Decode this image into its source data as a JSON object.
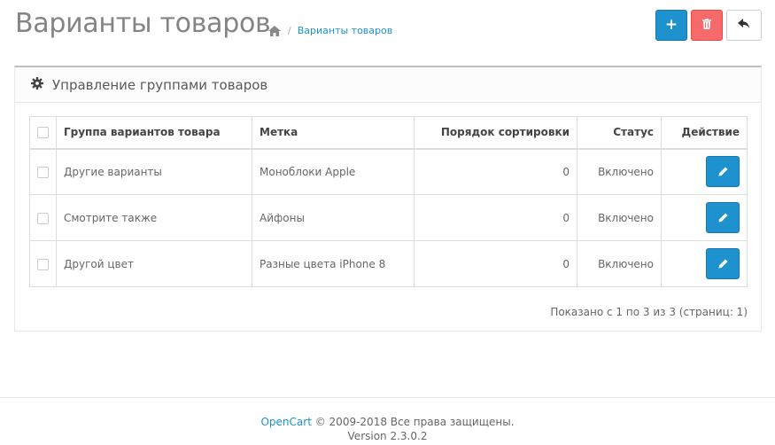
{
  "header": {
    "title": "Варианты товаров",
    "breadcrumb": {
      "current": "Варианты товаров"
    },
    "buttons": {
      "add": "+",
      "delete": "trash-icon",
      "back": "reply-icon"
    }
  },
  "panel": {
    "title": "Управление группами товаров",
    "table": {
      "headers": {
        "group": "Группа вариантов товара",
        "label": "Метка",
        "sort": "Порядок сортировки",
        "status": "Статус",
        "action": "Действие"
      },
      "rows": [
        {
          "group": "Другие варианты",
          "label": "Моноблоки Apple",
          "sort": "0",
          "status": "Включено"
        },
        {
          "group": "Смотрите также",
          "label": "Айфоны",
          "sort": "0",
          "status": "Включено"
        },
        {
          "group": "Другой цвет",
          "label": "Разные цвета iPhone 8",
          "sort": "0",
          "status": "Включено"
        }
      ]
    },
    "pagination_text": "Показано с 1 по 3 из 3 (страниц: 1)"
  },
  "footer": {
    "link": "OpenCart",
    "copyright": "© 2009-2018 Все права защищены.",
    "version": "Version 2.3.0.2"
  },
  "colors": {
    "primary": "#1e91cf",
    "danger": "#f56b6b"
  }
}
